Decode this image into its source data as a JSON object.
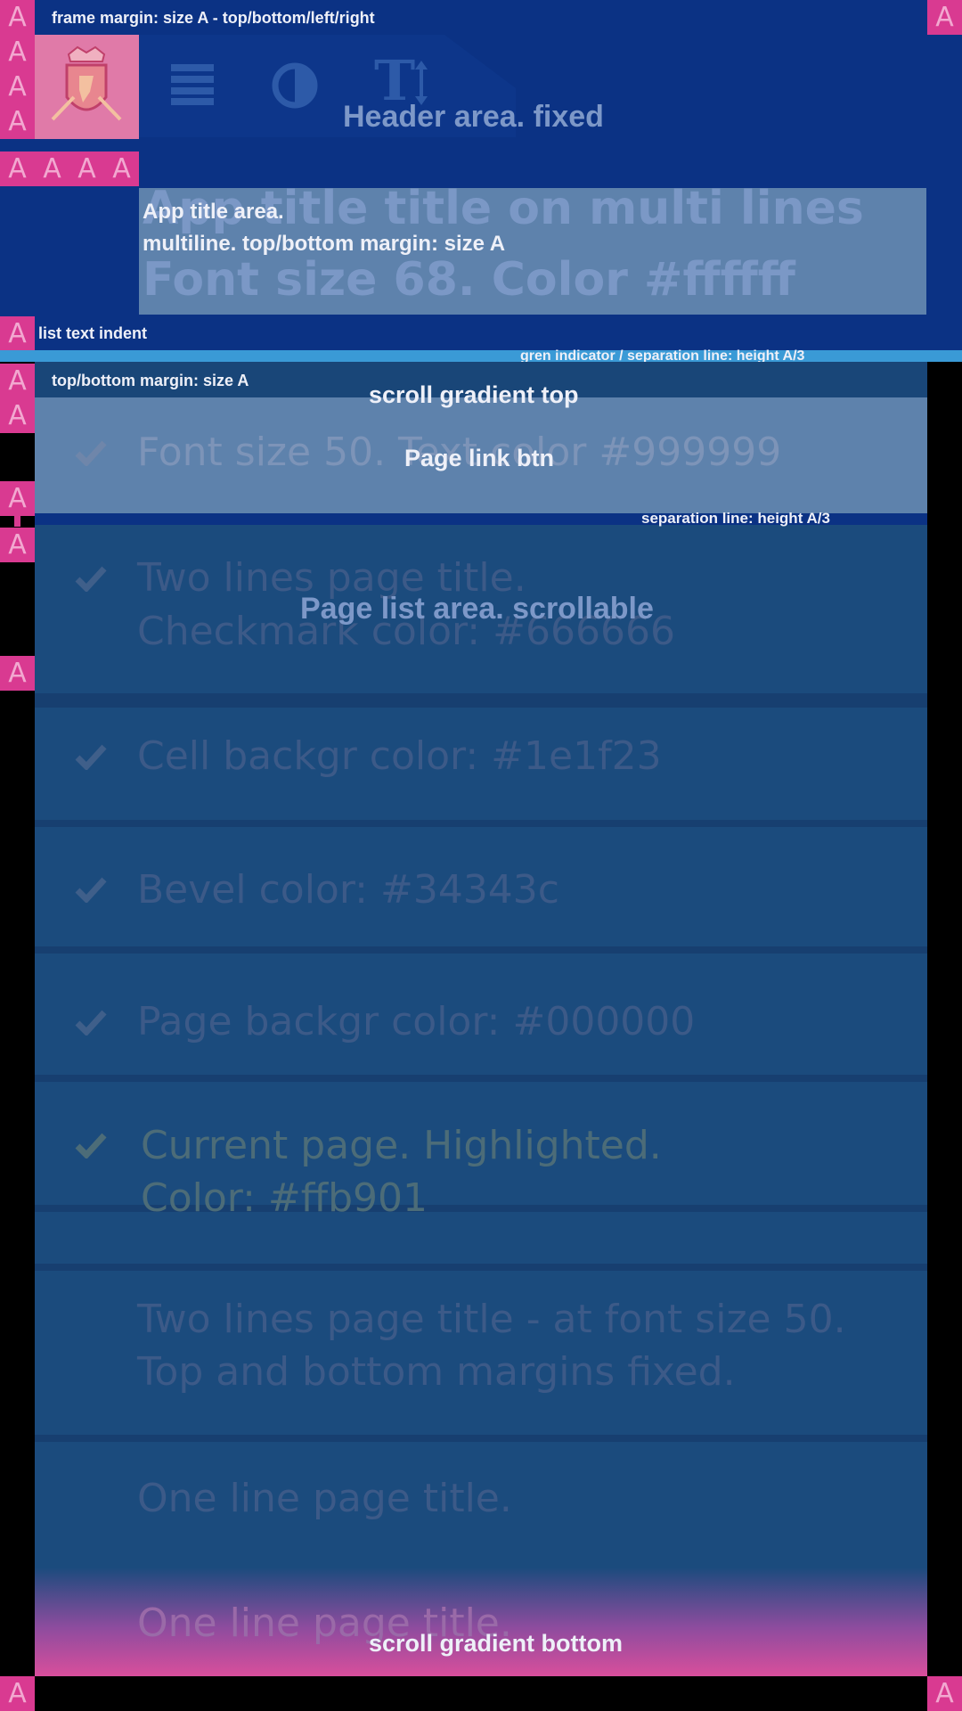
{
  "colors": {
    "header_bg": "#0b3284",
    "list_bg": "#1b4b7d",
    "divider": "#173f70",
    "indicator": "#3a9ad6",
    "marker": "#d93a91",
    "note_text": "#eef0f8",
    "muted_text": "#3c5a88",
    "check": "#3f5f8a",
    "highlight_text": "#4c6c78"
  },
  "marker_letter": "A",
  "notes": {
    "frame_margin": "frame margin: size A - top/bottom/left/right",
    "header_area": "Header area. fixed",
    "app_title_area": "App title area.",
    "title_margin": "multiline. top/bottom margin:  size A",
    "list_indent": "list text indent",
    "green_indicator": "gren indicator / separation line: height A/3",
    "list_margin": "top/bottom margin: size A",
    "scroll_top": "scroll gradient top",
    "page_link_btn": "Page link btn",
    "separation_line": "separation line: height A/3",
    "list_area": "Page list area. scrollable",
    "scroll_bottom": "scroll gradient bottom"
  },
  "header": {
    "icons": [
      "coat-of-arms-logo",
      "menu-icon",
      "contrast-icon",
      "text-size-icon"
    ],
    "text_size_glyph": "T"
  },
  "app_title": {
    "line1": "App title title on multi lines",
    "line2": "Font size 68. Color #ffffff"
  },
  "list": {
    "items": [
      {
        "line1": "Font size 50. Text color #999999",
        "line2": "",
        "checked": true,
        "current": false
      },
      {
        "line1": "Two lines page title.",
        "line2": " Checkmark color: #666666",
        "checked": true,
        "current": false
      },
      {
        "line1": "Cell backgr color: #1e1f23",
        "line2": "",
        "checked": true,
        "current": false
      },
      {
        "line1": "Bevel color: #34343c",
        "line2": "",
        "checked": true,
        "current": false
      },
      {
        "line1": "Page backgr color:  #000000",
        "line2": "",
        "checked": true,
        "current": false
      },
      {
        "line1": "Current page. Highlighted.",
        "line2": "Color: #ffb901",
        "checked": true,
        "current": true
      },
      {
        "line1": "Two lines page title - at font size 50.",
        "line2": "Top and bottom margins fixed.",
        "checked": false,
        "current": false
      },
      {
        "line1": "One line page title.",
        "line2": "",
        "checked": false,
        "current": false
      },
      {
        "line1": "One line page title.",
        "line2": "",
        "checked": false,
        "current": false
      }
    ]
  }
}
